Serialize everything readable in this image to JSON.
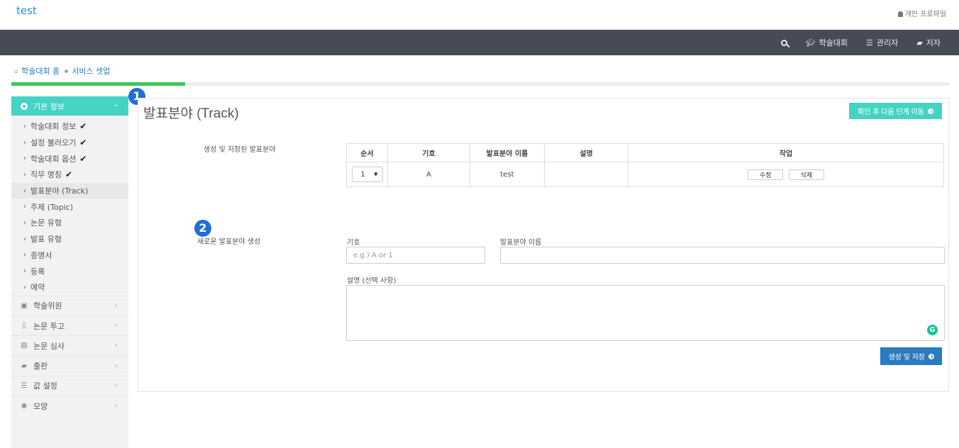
{
  "app": {
    "brand": "test",
    "profile_label": "개인 프로파일"
  },
  "nav": {
    "items": [
      {
        "label": "학술대회",
        "icon": "graduation-cap-icon"
      },
      {
        "label": "관리자",
        "icon": "server-icon"
      },
      {
        "label": "저자",
        "icon": "book-icon"
      }
    ]
  },
  "breadcrumb": {
    "home": "학술대회 홈",
    "current": "서비스 셋업"
  },
  "progress": {
    "percent": 18.5
  },
  "sidebar": {
    "section_title": "기본 정보",
    "sub_items": [
      {
        "label": "학술대회 정보",
        "check": "✔"
      },
      {
        "label": "설정 불러오기",
        "check": "✔"
      },
      {
        "label": "학술대회 옵션",
        "check": "✔"
      },
      {
        "label": "직무 명칭",
        "check": "✔"
      },
      {
        "label": "발표분야 (Track)",
        "check": ""
      },
      {
        "label": "주제 (Topic)",
        "check": ""
      },
      {
        "label": "논문 유형",
        "check": ""
      },
      {
        "label": "발표 유형",
        "check": ""
      },
      {
        "label": "증명서",
        "check": ""
      },
      {
        "label": "등록",
        "check": ""
      },
      {
        "label": "예약",
        "check": ""
      }
    ],
    "sections": [
      {
        "label": "학술위원",
        "icon": "briefcase-icon"
      },
      {
        "label": "논문 투고",
        "icon": "file-icon"
      },
      {
        "label": "논문 심사",
        "icon": "edit-icon"
      },
      {
        "label": "출판",
        "icon": "book-icon"
      },
      {
        "label": "값 설정",
        "icon": "sliders-icon"
      },
      {
        "label": "모양",
        "icon": "eye-icon"
      }
    ]
  },
  "badges": [
    "1",
    "2"
  ],
  "main": {
    "title": "발표분야 (Track)",
    "next_button": "확인 후 다음 단계 이동",
    "list_label": "생성 및 저장된 발표분야",
    "table": {
      "headers": [
        "순서",
        "기호",
        "발표분야 이름",
        "설명",
        "작업"
      ],
      "rows": [
        {
          "order": "1",
          "code": "A",
          "name": "test",
          "description": "",
          "edit": "수정",
          "delete": "삭제"
        }
      ]
    },
    "new_label": "새로운 발표분야 생성",
    "form": {
      "code_label": "기호",
      "code_placeholder": "e.g.) A or 1",
      "name_label": "발표분야 이름",
      "name_value": "",
      "desc_label": "설명 (선택 사항)",
      "desc_value": "",
      "grammarly": "G",
      "save_button": "생성 및 저장"
    }
  },
  "colors": {
    "accent": "#45d3c3",
    "navbar": "#474b57",
    "primary": "#2a7bbf",
    "progress": "#3ec55a",
    "badge": "#1f6fd4"
  }
}
